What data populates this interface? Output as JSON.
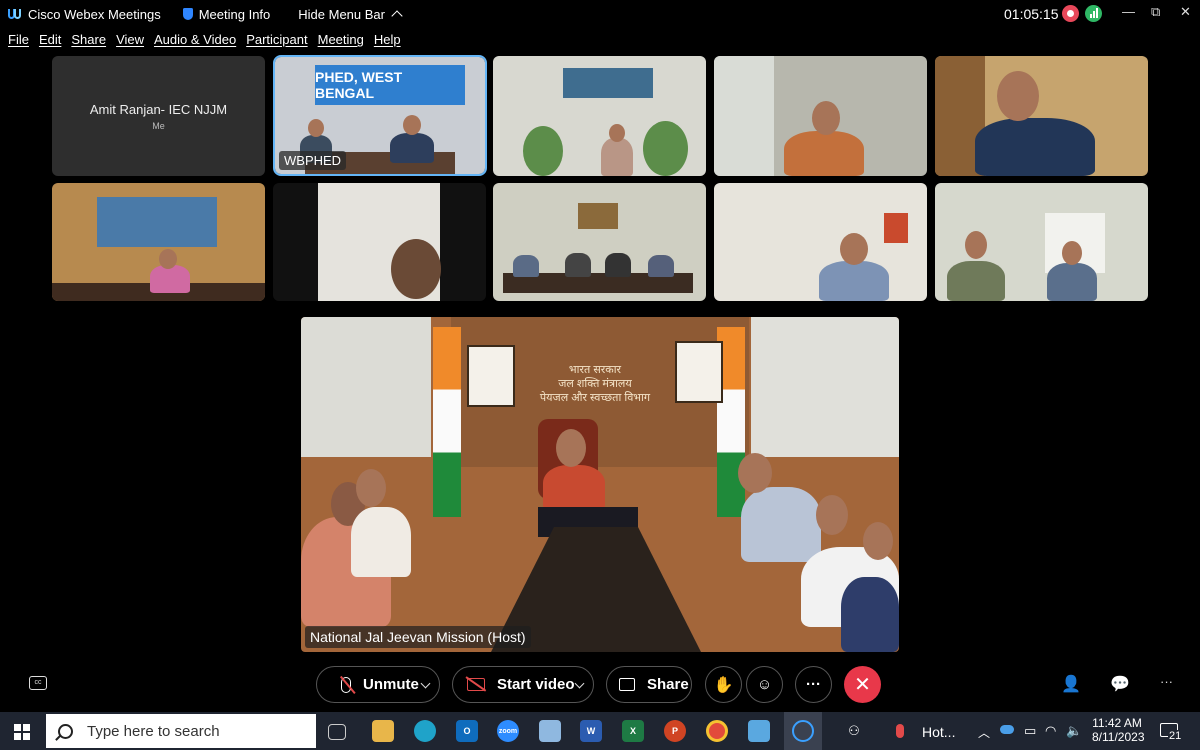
{
  "titlebar": {
    "app_name": "Cisco Webex Meetings",
    "meeting_info": "Meeting Info",
    "hide_menu": "Hide Menu Bar",
    "timer": "01:05:15",
    "minimize": "—",
    "restore": "⧉",
    "close": "✕"
  },
  "menu": [
    "File",
    "Edit",
    "Share",
    "View",
    "Audio & Video",
    "Participant",
    "Meeting",
    "Help"
  ],
  "tiles": {
    "self_name": "Amit Ranjan- IEC NJJM",
    "self_sub": "Me",
    "wbphed_label": "WBPHED",
    "wbphed_banner": "PHED, WEST BENGAL"
  },
  "main_video": {
    "label": "National Jal Jeevan Mission (Host)",
    "wall_text_1": "भारत सरकार",
    "wall_text_2": "जल शक्ति मंत्रालय",
    "wall_text_3": "पेयजल और स्वच्छता विभाग"
  },
  "controls": {
    "unmute": "Unmute",
    "start_video": "Start video",
    "share": "Share",
    "more": "···",
    "leave": "✕"
  },
  "taskbar": {
    "search_placeholder": "Type here to search",
    "weather": "Hot...",
    "time": "11:42 AM",
    "date": "8/11/2023",
    "notifications": "21",
    "zoom_label": "zoom"
  }
}
